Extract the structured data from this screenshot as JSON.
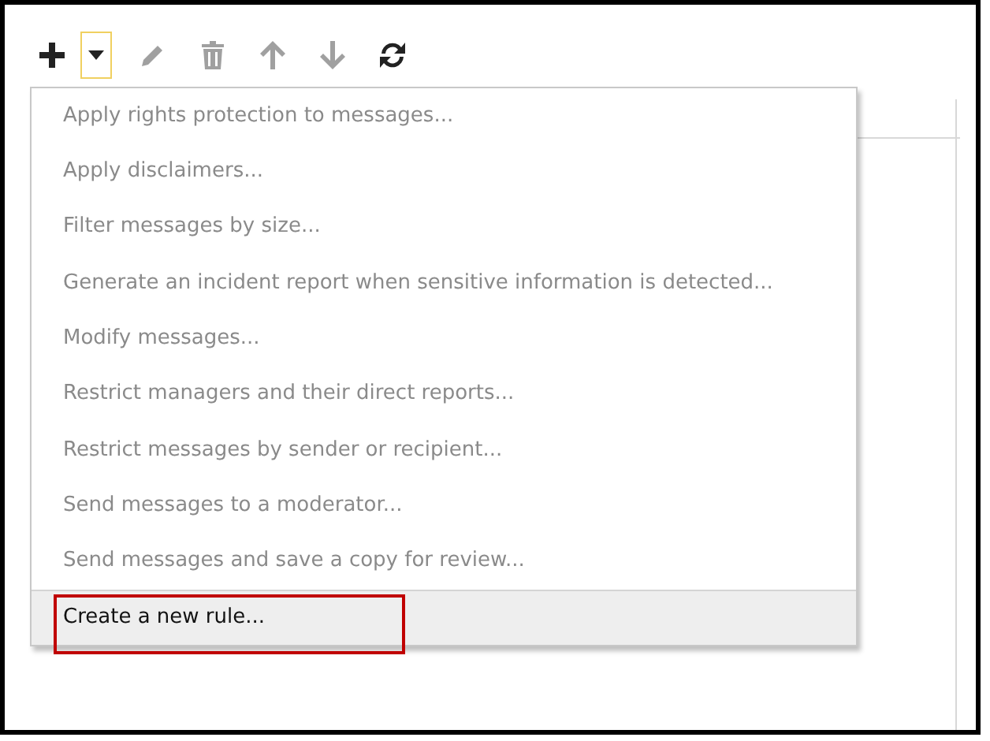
{
  "toolbar": [
    {
      "kind": "add",
      "disabled": false,
      "focused": false
    },
    {
      "kind": "dropdown",
      "disabled": false,
      "focused": true
    },
    {
      "kind": "edit",
      "disabled": true,
      "focused": false
    },
    {
      "kind": "delete",
      "disabled": true,
      "focused": false
    },
    {
      "kind": "up",
      "disabled": true,
      "focused": false
    },
    {
      "kind": "down",
      "disabled": true,
      "focused": false
    },
    {
      "kind": "refresh",
      "disabled": false,
      "focused": false
    }
  ],
  "menu": {
    "items": [
      {
        "label": "Apply rights protection to messages...",
        "selected": false,
        "outlined": false
      },
      {
        "label": "Apply disclaimers...",
        "selected": false,
        "outlined": false
      },
      {
        "label": "Filter messages by size...",
        "selected": false,
        "outlined": false
      },
      {
        "label": "Generate an incident report when sensitive information is detected...",
        "selected": false,
        "outlined": false
      },
      {
        "label": "Modify messages...",
        "selected": false,
        "outlined": false
      },
      {
        "label": "Restrict managers and their direct reports...",
        "selected": false,
        "outlined": false
      },
      {
        "label": "Restrict messages by sender or recipient...",
        "selected": false,
        "outlined": false
      },
      {
        "label": "Send messages to a moderator...",
        "selected": false,
        "outlined": false
      },
      {
        "label": "Send messages and save a copy for review...",
        "selected": false,
        "outlined": false
      },
      {
        "label": "Create a new rule...",
        "selected": true,
        "outlined": true
      }
    ]
  }
}
